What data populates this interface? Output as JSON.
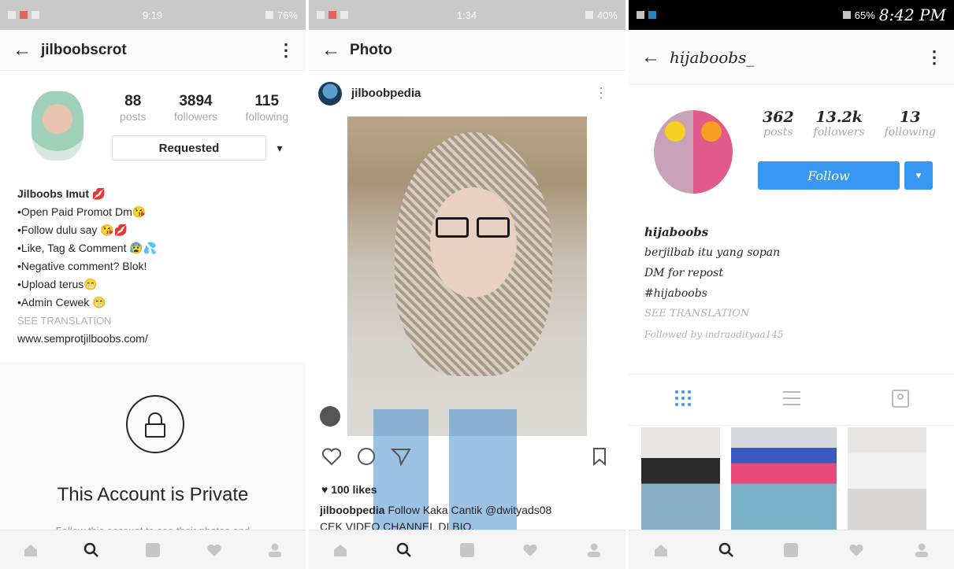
{
  "panel1": {
    "status": {
      "time": "9:19",
      "battery": "76%"
    },
    "header": {
      "back": "←",
      "title": "jilboobscrot",
      "more": "⋮"
    },
    "stats": [
      {
        "value": "88",
        "label": "posts"
      },
      {
        "value": "3894",
        "label": "followers"
      },
      {
        "value": "115",
        "label": "following"
      }
    ],
    "requested_label": "Requested",
    "dropdown_glyph": "▾",
    "bio": {
      "name": "Jilboobs Imut 💋",
      "lines": [
        "•Open Paid Promot Dm😘",
        "•Follow dulu say 😘💋",
        "•Like, Tag & Comment 😰💦",
        "•Negative comment? Blok!",
        "•Upload terus😁",
        "•Admin Cewek 😁"
      ],
      "translation": "SEE TRANSLATION",
      "website": "www.semprotjilboobs.com/"
    },
    "private_title": "This Account is Private",
    "private_sub": "Follow this account to see their photos and"
  },
  "panel2": {
    "status": {
      "time": "1:34",
      "battery": "40%"
    },
    "header": {
      "back": "←",
      "title": "Photo"
    },
    "post": {
      "username": "jilboobpedia",
      "more": "⋮",
      "likes": "♥ 100 likes",
      "caption_user": "jilboobpedia",
      "caption_text": " Follow Kaka Cantik @dwityads08",
      "caption_line2": "CEK VIDEO CHANNEL DI BIO."
    }
  },
  "panel3": {
    "status": {
      "time": "8:42 PM",
      "battery": "65%"
    },
    "header": {
      "back": "←",
      "title": "hijaboobs_",
      "more": "⋮"
    },
    "stats": [
      {
        "value": "362",
        "label": "posts"
      },
      {
        "value": "13.2k",
        "label": "followers"
      },
      {
        "value": "13",
        "label": "following"
      }
    ],
    "follow_label": "Follow",
    "bio": {
      "name": "hijaboobs",
      "lines": [
        "berjilbab itu yang sopan",
        "DM for repost",
        "#hijaboobs"
      ],
      "translation": "SEE TRANSLATION",
      "followed_by": "Followed by indraadityaa145"
    }
  },
  "colors": {
    "accent": "#3897f0",
    "muted": "#a9a9a9",
    "bg": "#fafafa"
  }
}
